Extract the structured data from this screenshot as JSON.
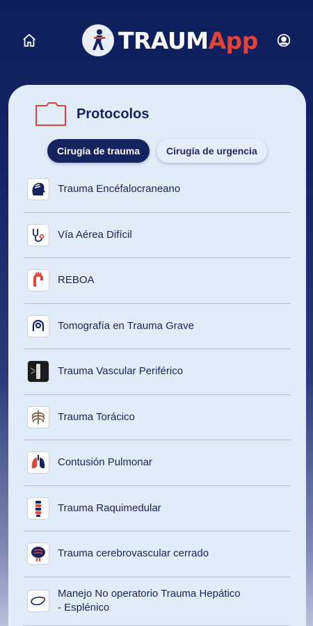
{
  "header": {
    "logo_main": "TRAUM",
    "logo_accent": "App",
    "home_icon": "home-icon",
    "user_icon": "user-account-icon"
  },
  "section": {
    "title": "Protocolos",
    "icon": "folder-icon"
  },
  "tabs": [
    {
      "label": "Cirugía de trauma",
      "active": true
    },
    {
      "label": "Cirugía de urgencia",
      "active": false
    }
  ],
  "protocols": [
    {
      "label": "Trauma Encéfalocraneano",
      "icon": "head-icon"
    },
    {
      "label": "Vía Aérea Difícil",
      "icon": "stethoscope-icon"
    },
    {
      "label": "REBOA",
      "icon": "aorta-icon"
    },
    {
      "label": "Tomografía en Trauma Grave",
      "icon": "ct-scanner-icon"
    },
    {
      "label": "Trauma Vascular Periférico",
      "icon": "limb-xray-icon"
    },
    {
      "label": "Trauma Torácico",
      "icon": "ribcage-icon"
    },
    {
      "label": "Contusión Pulmonar",
      "icon": "lungs-icon"
    },
    {
      "label": "Trauma Raquimedular",
      "icon": "spine-icon"
    },
    {
      "label": "Trauma cerebrovascular cerrado",
      "icon": "brain-vessels-icon"
    },
    {
      "label": "Manejo No operatorio Trauma Hepático - Esplénico",
      "icon": "liver-icon"
    }
  ],
  "colors": {
    "navy": "#15235e",
    "accent_red": "#e2443a",
    "card_bg": "#e1ecf9"
  }
}
